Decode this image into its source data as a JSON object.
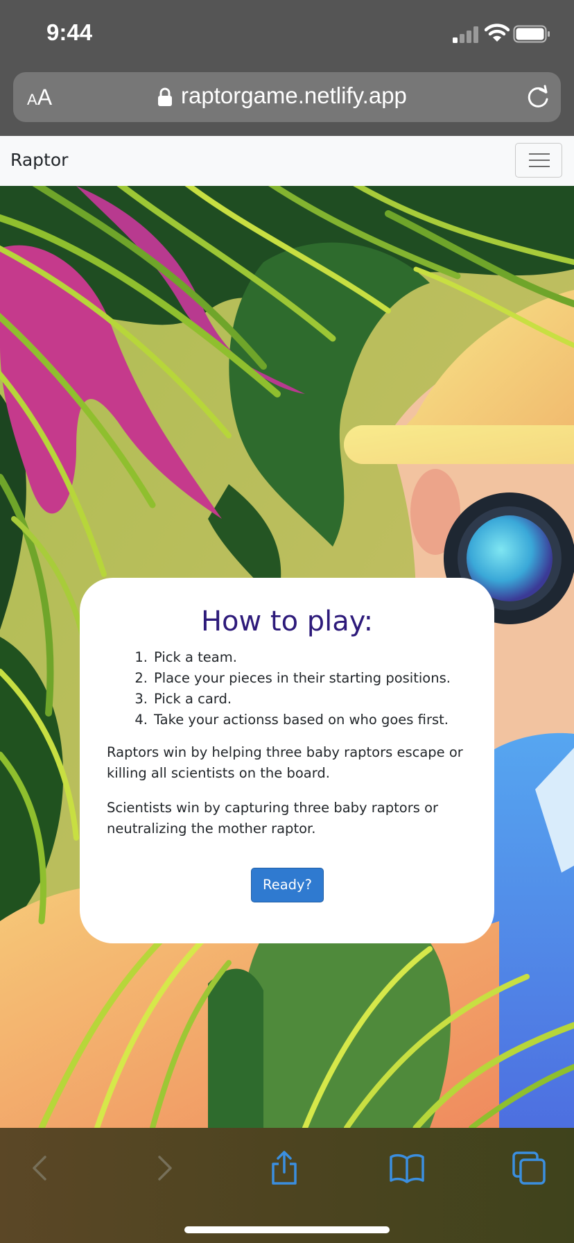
{
  "status_bar": {
    "time": "9:44"
  },
  "browser": {
    "text_size_label_small": "A",
    "text_size_label_large": "A",
    "url": "raptorgame.netlify.app"
  },
  "navbar": {
    "brand": "Raptor"
  },
  "modal": {
    "title": "How to play:",
    "steps": [
      {
        "num": "1.",
        "text": "Pick a team."
      },
      {
        "num": "2.",
        "text": "Place your pieces in their starting positions."
      },
      {
        "num": "3.",
        "text": "Pick a card."
      },
      {
        "num": "4.",
        "text": "Take your actionss based on who goes first."
      }
    ],
    "raptors_rule": "Raptors win by helping three baby raptors escape or killing all scientists on the board.",
    "scientists_rule": "Scientists win by capturing three baby raptors or neutralizing the mother raptor.",
    "ready_label": "Ready?"
  },
  "toolbar": {
    "icons": [
      "back-icon",
      "forward-icon",
      "share-icon",
      "bookmarks-icon",
      "tabs-icon"
    ]
  },
  "colors": {
    "title": "#2d1a7a",
    "button": "#2f7ad0",
    "chrome": "#555555"
  }
}
